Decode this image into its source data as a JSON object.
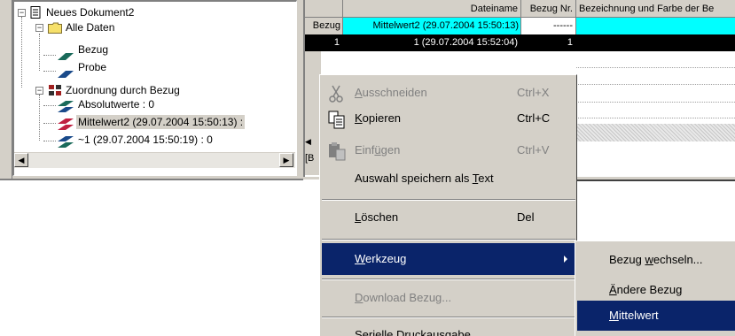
{
  "tree": {
    "root": "Neues Dokument2",
    "all_data": "Alle Daten",
    "bezug": "Bezug",
    "probe": "Probe",
    "zuordnung": "Zuordnung durch Bezug",
    "absolutwerte": "Absolutwerte : 0",
    "mittelwert": "Mittelwert2 (29.07.2004 15:50:13) :",
    "sample1": "~1 (29.07.2004 15:50:19) : 0"
  },
  "table": {
    "headers": [
      "Dateiname",
      "Bezug Nr.",
      "Bezeichnung und Farbe der Be"
    ],
    "rows": [
      {
        "rowlabel": "Bezug",
        "filename": "Mittelwert2 (29.07.2004 15:50:13)",
        "nr": "------",
        "desc": ""
      },
      {
        "rowlabel": "1",
        "filename": "1 (29.07.2004 15:52:04)",
        "nr": "1",
        "desc": ""
      }
    ],
    "partial_label": "[B"
  },
  "menu": {
    "cut": {
      "label_pre": "",
      "label_u": "A",
      "label_post": "usschneiden",
      "shortcut": "Ctrl+X"
    },
    "copy": {
      "label_pre": "",
      "label_u": "K",
      "label_post": "opieren",
      "shortcut": "Ctrl+C"
    },
    "paste": {
      "label_pre": "Einf",
      "label_u": "ü",
      "label_post": "gen",
      "shortcut": "Ctrl+V"
    },
    "save_text": {
      "label_pre": "Auswahl speichern als ",
      "label_u": "T",
      "label_post": "ext"
    },
    "delete": {
      "label_pre": "",
      "label_u": "L",
      "label_post": "öschen",
      "shortcut": "Del"
    },
    "tool": {
      "label_pre": "",
      "label_u": "W",
      "label_post": "erkzeug"
    },
    "download": {
      "label_pre": "",
      "label_u": "D",
      "label_post": "ownload Bezug..."
    },
    "serial": {
      "label": "Serielle Druckausgabe"
    }
  },
  "submenu": {
    "switch": {
      "label_pre": "Bezug ",
      "label_u": "w",
      "label_post": "echseln..."
    },
    "change": {
      "label_pre": "",
      "label_u": "Ä",
      "label_post": "ndere Bezug"
    },
    "mean": {
      "label_pre": "",
      "label_u": "M",
      "label_post": "ittelwert"
    }
  },
  "colors": {
    "highlight": "#0a246a",
    "table_highlight": "#00ffff",
    "face": "#d4d0c8"
  }
}
